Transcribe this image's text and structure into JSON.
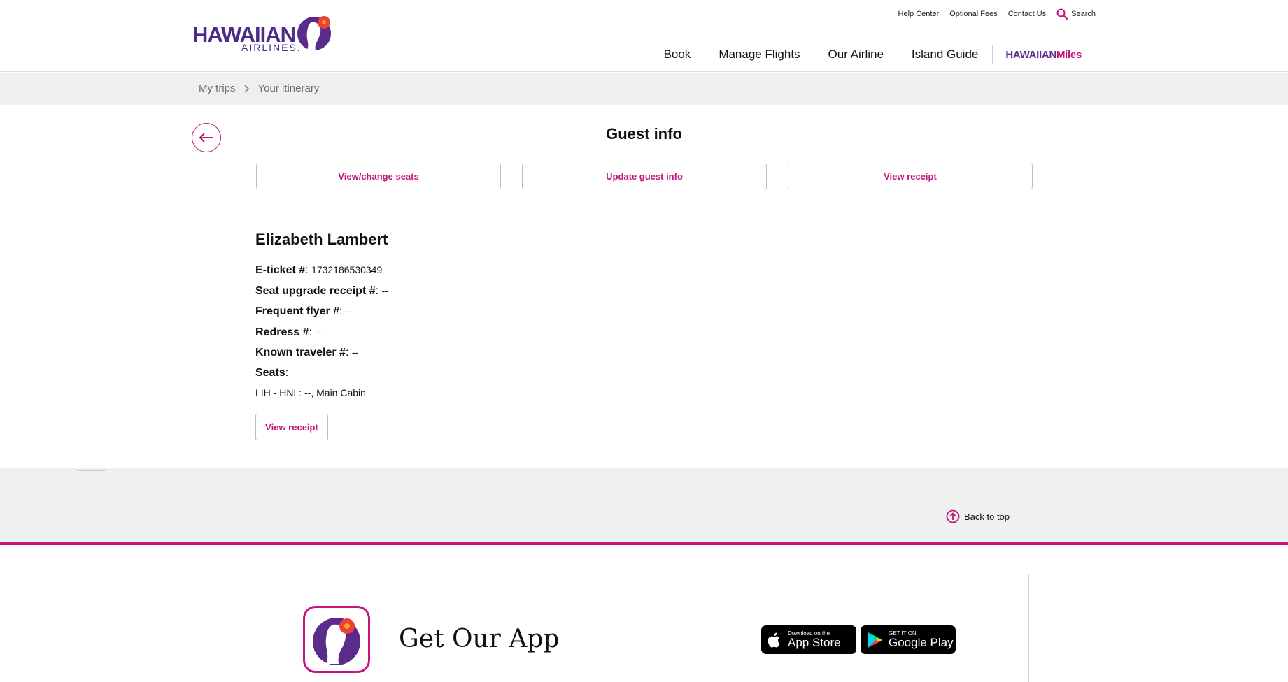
{
  "brand": {
    "word": "HAWAIIAN",
    "sub": "AIRLINES."
  },
  "utility_links": {
    "help": "Help Center",
    "fees": "Optional Fees",
    "contact": "Contact Us",
    "search": "Search"
  },
  "nav": {
    "book": "Book",
    "manage": "Manage Flights",
    "airline": "Our Airline",
    "island": "Island Guide",
    "miles_a": "HAWAIIAN",
    "miles_b": "Miles"
  },
  "breadcrumb": {
    "trips": "My trips",
    "current": "Your itinerary"
  },
  "page": {
    "title": "Guest info"
  },
  "actions": {
    "seats": "View/change seats",
    "update": "Update guest info",
    "receipt": "View receipt"
  },
  "guest": {
    "name": "Elizabeth Lambert",
    "eticket_label": "E-ticket #",
    "eticket_value": "1732186530349",
    "upgrade_label": "Seat upgrade receipt #",
    "upgrade_value": "--",
    "ff_label": "Frequent flyer #",
    "ff_value": "--",
    "redress_label": "Redress #",
    "redress_value": "--",
    "ktn_label": "Known traveler #",
    "ktn_value": "--",
    "seats_label": "Seats",
    "seat_line": "LIH - HNL: --, Main Cabin",
    "receipt": "View receipt"
  },
  "footer": {
    "back_to_top": "Back to top",
    "app_title": "Get Our App",
    "appstore_small": "Download on the",
    "appstore_big": "App Store",
    "play_small": "GET IT ON",
    "play_big": "Google Play"
  },
  "colors": {
    "accent": "#c3157d",
    "brand_purple": "#4b2a8a",
    "band": "#eff1f0"
  },
  "icons": [
    "search-icon",
    "chevron-right-icon",
    "arrow-left-icon",
    "arrow-up-circle-icon",
    "apple-icon",
    "google-play-icon"
  ]
}
